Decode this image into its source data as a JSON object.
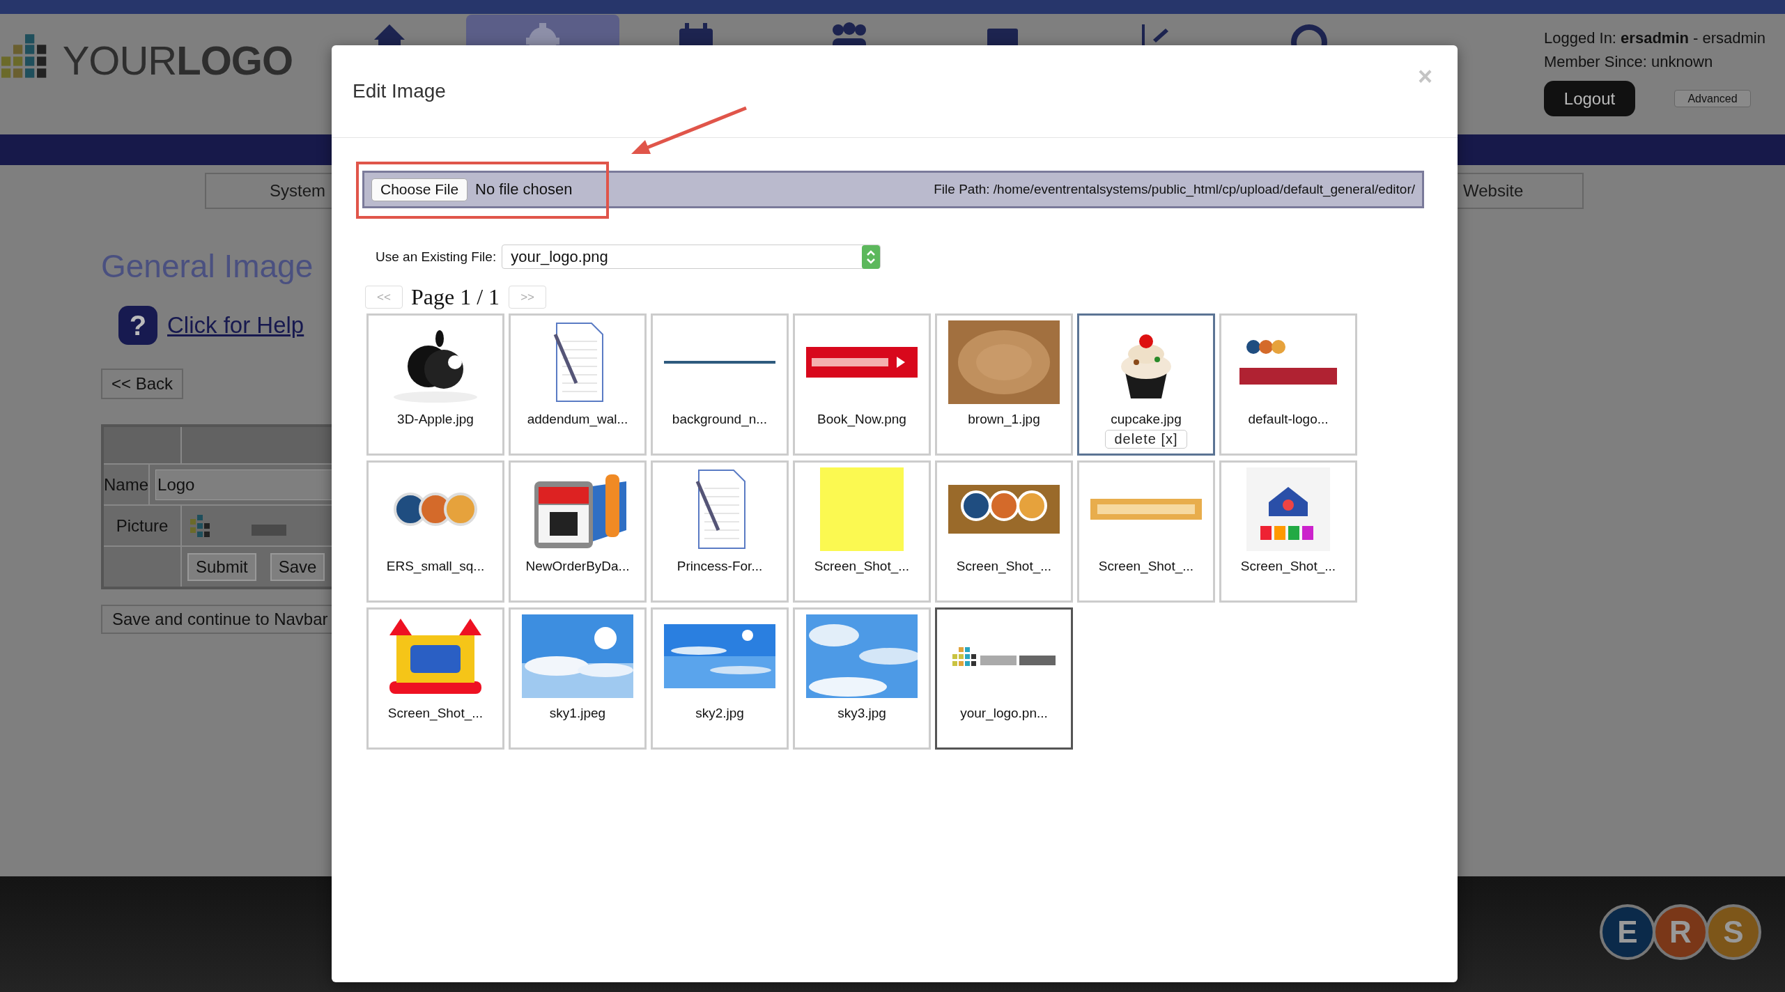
{
  "header": {
    "logo": "YOUR**LOGO**",
    "nav_icons": [
      {
        "kind": "house",
        "selected": false
      },
      {
        "kind": "gear",
        "selected": true
      },
      {
        "kind": "calendar",
        "selected": false
      },
      {
        "kind": "people",
        "selected": false
      },
      {
        "kind": "folder",
        "selected": false
      },
      {
        "kind": "chart",
        "selected": false
      },
      {
        "kind": "circle",
        "selected": false
      }
    ],
    "logged_in": "Logged In: **ersadmin** - ersadmin",
    "member_since": "Member Since: unknown",
    "logout_button": "Logout",
    "advanced_button": "Advanced"
  },
  "menu": [
    {
      "label": "System"
    },
    {
      "label": "Website"
    }
  ],
  "page": {
    "title": "General Image",
    "help_icon": "?",
    "help_link": "Click for Help",
    "back_button": "<< Back",
    "form": {
      "rows": [
        {
          "kind": "input",
          "label": "Name",
          "value": "Logo"
        },
        {
          "label": "Picture"
        },
        {
          "kind": "buttons",
          "buttons": [
            "Submit",
            "Save"
          ]
        }
      ]
    },
    "save_continue_button": "Save and continue to Navbar"
  },
  "footer": {
    "logo_letters": [
      {
        "letter": "E",
        "color": "#0b2a4a"
      },
      {
        "letter": "R",
        "color": "#7a3718"
      },
      {
        "letter": "S",
        "color": "#7d5619"
      }
    ]
  },
  "modal": {
    "title": "Edit Image",
    "close": "×",
    "choose_button": "Choose File",
    "file_status": "No file chosen",
    "file_path": "File Path: /home/eventrentalsystems/public_html/cp/upload/default_general/editor/",
    "existing_label": "Use an Existing File:",
    "existing_value": "your_logo.png",
    "pager": {
      "prev": "<<",
      "page": "Page 1 / 1",
      "next": ">>"
    },
    "files": [
      {
        "name": "3D-Apple.jpg",
        "kind": "apple",
        "selected": false,
        "current": false
      },
      {
        "name": "addendum_wal...",
        "kind": "document",
        "selected": false,
        "current": false
      },
      {
        "name": "background_n...",
        "kind": "line",
        "selected": false,
        "current": false
      },
      {
        "name": "Book_Now.png",
        "kind": "red-banner",
        "selected": false,
        "current": false
      },
      {
        "name": "brown_1.jpg",
        "kind": "texture",
        "selected": false,
        "current": false
      },
      {
        "name": "cupcake.jpg",
        "kind": "cupcake",
        "selected": true,
        "current": false,
        "delete": "delete [x]"
      },
      {
        "name": "default-logo...",
        "kind": "site-logo",
        "selected": false,
        "current": false
      },
      {
        "name": "ERS_small_sq...",
        "kind": "circles",
        "selected": false,
        "current": false
      },
      {
        "name": "NewOrderByDa...",
        "kind": "calendar",
        "selected": false,
        "current": false
      },
      {
        "name": "Princess-For...",
        "kind": "document",
        "selected": false,
        "current": false
      },
      {
        "name": "Screen_Shot_...",
        "kind": "yellow",
        "selected": false,
        "current": false
      },
      {
        "name": "Screen_Shot_...",
        "kind": "brown-banner",
        "selected": false,
        "current": false
      },
      {
        "name": "Screen_Shot_...",
        "kind": "orange-banner",
        "selected": false,
        "current": false
      },
      {
        "name": "Screen_Shot_...",
        "kind": "bouncer",
        "selected": false,
        "current": false
      },
      {
        "name": "Screen_Shot_...",
        "kind": "bounce-house",
        "selected": false,
        "current": false
      },
      {
        "name": "sky1.jpeg",
        "kind": "sky-sun",
        "selected": false,
        "current": false
      },
      {
        "name": "sky2.jpg",
        "kind": "sky-sea",
        "selected": false,
        "current": false
      },
      {
        "name": "sky3.jpg",
        "kind": "sky-clouds",
        "selected": false,
        "current": false
      },
      {
        "name": "your_logo.pn...",
        "kind": "squares-logo",
        "selected": false,
        "current": true
      }
    ]
  }
}
